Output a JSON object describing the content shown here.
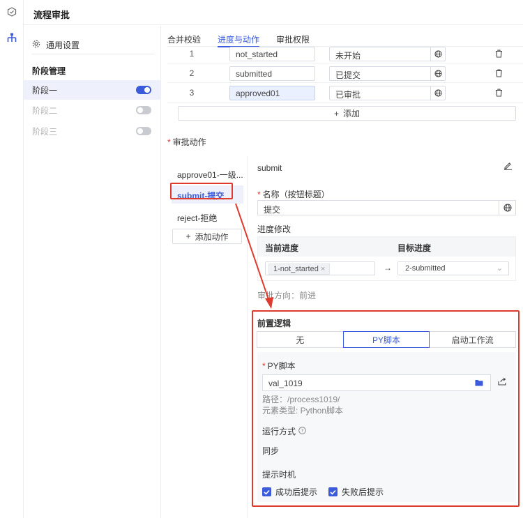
{
  "header": {
    "title": "流程审批"
  },
  "rail": {
    "icons": [
      "hexagon-check-icon",
      "org-tree-icon"
    ]
  },
  "sidebar": {
    "general_settings": "通用设置",
    "stage_header": "阶段管理",
    "stages": [
      {
        "label": "阶段一",
        "enabled": true,
        "active": true
      },
      {
        "label": "阶段二",
        "enabled": false,
        "active": false
      },
      {
        "label": "阶段三",
        "enabled": false,
        "active": false
      }
    ]
  },
  "tabs": [
    {
      "label": "合并校验",
      "active": false
    },
    {
      "label": "进度与动作",
      "active": true
    },
    {
      "label": "审批权限",
      "active": false
    }
  ],
  "progress_rows": [
    {
      "num": "1",
      "key": "not_started",
      "name": "未开始",
      "highlight": false
    },
    {
      "num": "2",
      "key": "submitted",
      "name": "已提交",
      "highlight": false
    },
    {
      "num": "3",
      "key": "approved01",
      "name": "已审批",
      "highlight": true
    }
  ],
  "progress_add": "添加",
  "actions_section": {
    "label": "审批动作",
    "items": [
      {
        "label": "approve01-一级...",
        "active": false
      },
      {
        "label": "submit-提交",
        "active": true
      },
      {
        "label": "reject-拒绝",
        "active": false
      }
    ],
    "add_label": "添加动作"
  },
  "detail": {
    "name": "submit",
    "name_label": "名称（按钮标题）",
    "name_value": "提交",
    "progress_label": "进度修改",
    "current_header": "当前进度",
    "target_header": "目标进度",
    "current_tag": "1-not_started",
    "target_value": "2-submitted",
    "direction": "审批方向：前进",
    "pre_logic": {
      "title": "前置逻辑",
      "options": [
        {
          "label": "无",
          "active": false
        },
        {
          "label": "PY脚本",
          "active": true
        },
        {
          "label": "启动工作流",
          "active": false
        }
      ],
      "py_label": "PY脚本",
      "py_value": "val_1019",
      "path": "路径：/process1019/",
      "element_type": "元素类型: Python脚本",
      "run_mode_label": "运行方式",
      "run_mode_value": "同步",
      "hint_label": "提示时机",
      "hint_success": "成功后提示",
      "hint_fail": "失败后提示"
    }
  },
  "colors": {
    "accent": "#3b5bdb",
    "highlight_red": "#e03a2f"
  }
}
